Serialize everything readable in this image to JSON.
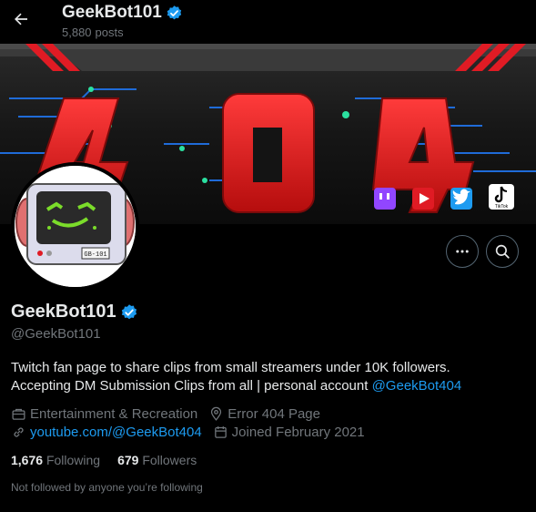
{
  "header": {
    "name": "GeekBot101",
    "post_count": "5,880",
    "post_label": "posts"
  },
  "banner": {
    "big_text": "404",
    "social_icons": [
      "twitch-icon",
      "youtube-icon",
      "twitter-icon",
      "tiktok-icon"
    ],
    "tiktok_label": "TikTok"
  },
  "avatar": {
    "label": "GB-101"
  },
  "profile": {
    "name": "GeekBot101",
    "handle": "@GeekBot101",
    "bio_line1": "Twitch fan page to share clips from small streamers under 10K followers.",
    "bio_line2": "Accepting DM Submission Clips from all | personal account",
    "bio_mention": "@GeekBot404",
    "category": "Entertainment & Recreation",
    "location": "Error 404 Page",
    "website": "youtube.com/@GeekBot404",
    "joined": "Joined February 2021",
    "following_count": "1,676",
    "following_label": "Following",
    "followers_count": "679",
    "followers_label": "Followers",
    "not_followed": "Not followed by anyone you’re following"
  },
  "colors": {
    "accent": "#1d9bf0",
    "verified": "#1d9bf0",
    "muted": "#71767b",
    "banner_red": "#e01b24"
  }
}
